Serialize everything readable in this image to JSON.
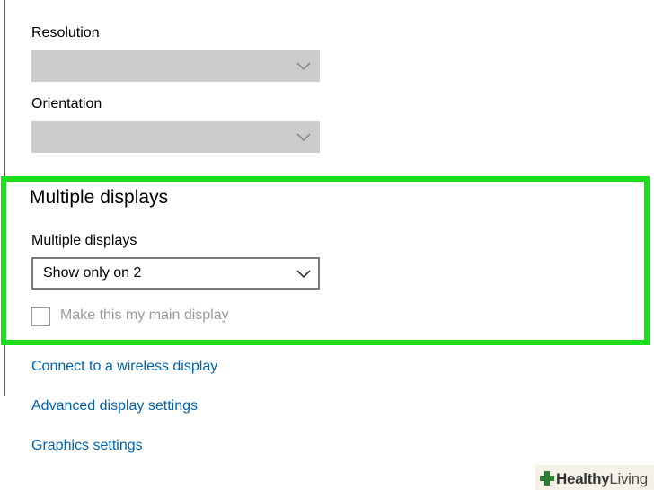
{
  "display": {
    "resolution_label": "Resolution",
    "orientation_label": "Orientation"
  },
  "multiple_displays": {
    "section_title": "Multiple displays",
    "field_label": "Multiple displays",
    "selected_value": "Show only on 2",
    "main_display_checkbox_label": "Make this my main display"
  },
  "links": {
    "wireless": "Connect to a wireless display",
    "advanced": "Advanced display settings",
    "graphics": "Graphics settings"
  },
  "watermark": {
    "brand_bold": "Healthy",
    "brand_light": "Living"
  },
  "colors": {
    "highlight": "#1adf1a",
    "link": "#0063b1",
    "disabled_dropdown": "#cccccc"
  }
}
